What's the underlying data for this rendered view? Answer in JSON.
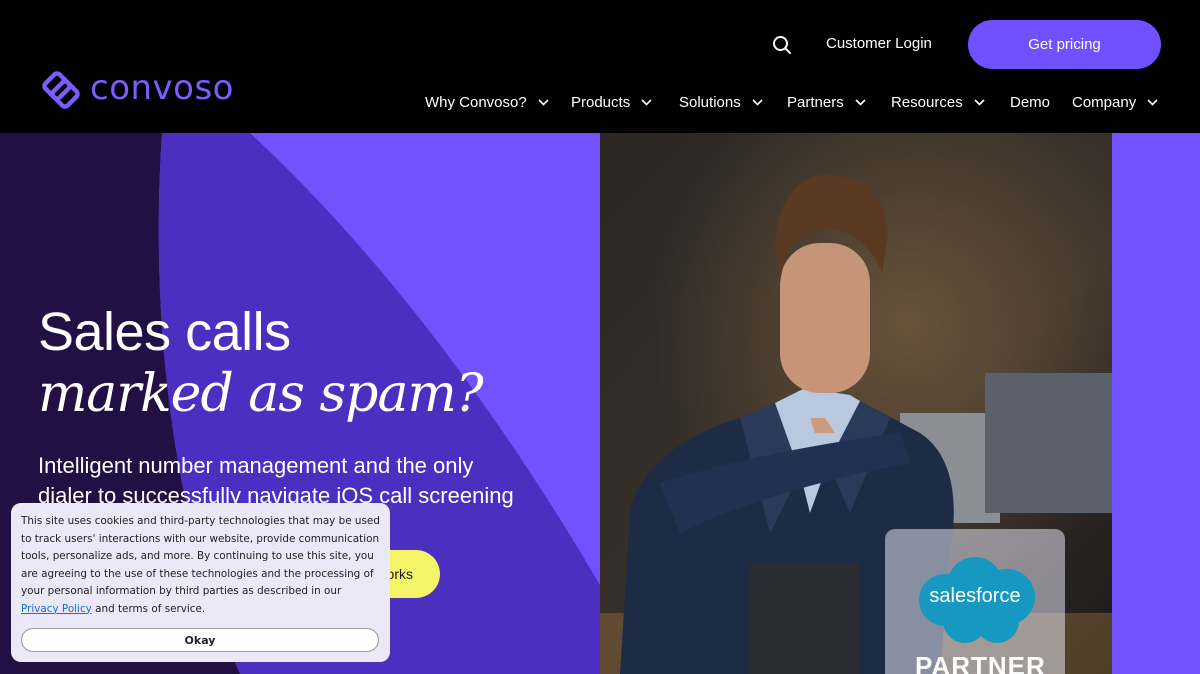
{
  "brand": {
    "name": "convoso",
    "accent_color": "#7050ff"
  },
  "header": {
    "search_icon": "search-icon",
    "login_label": "Customer Login",
    "pricing_label": "Get pricing"
  },
  "nav": {
    "items": [
      {
        "label": "Why Convoso?",
        "has_dropdown": true
      },
      {
        "label": "Products",
        "has_dropdown": true
      },
      {
        "label": "Solutions",
        "has_dropdown": true
      },
      {
        "label": "Partners",
        "has_dropdown": true
      },
      {
        "label": "Resources",
        "has_dropdown": true
      },
      {
        "label": "Demo",
        "has_dropdown": false
      },
      {
        "label": "Company",
        "has_dropdown": true
      }
    ]
  },
  "hero": {
    "headline_line1": "Sales calls",
    "headline_line2": "marked as spam?",
    "subtext": "Intelligent number management and the only dialer to successfully navigate iOS call screening",
    "cta_visible_label": "orks",
    "background_color": "#7252ff",
    "cta_color": "#f3f466"
  },
  "badge": {
    "cloud_text": "salesforce",
    "partner_text": "PARTNER",
    "cloud_color": "#1798c1"
  },
  "cookie": {
    "text": "This site uses cookies and third-party technologies that may be used to track users' interactions with our website, provide communication tools, personalize ads, and more. By continuing to use this site, you are agreeing to the use of these technologies and the processing of your personal information by third parties as described in our",
    "link_label": "Privacy Policy",
    "text_end": "and terms of service.",
    "button_label": "Okay"
  }
}
